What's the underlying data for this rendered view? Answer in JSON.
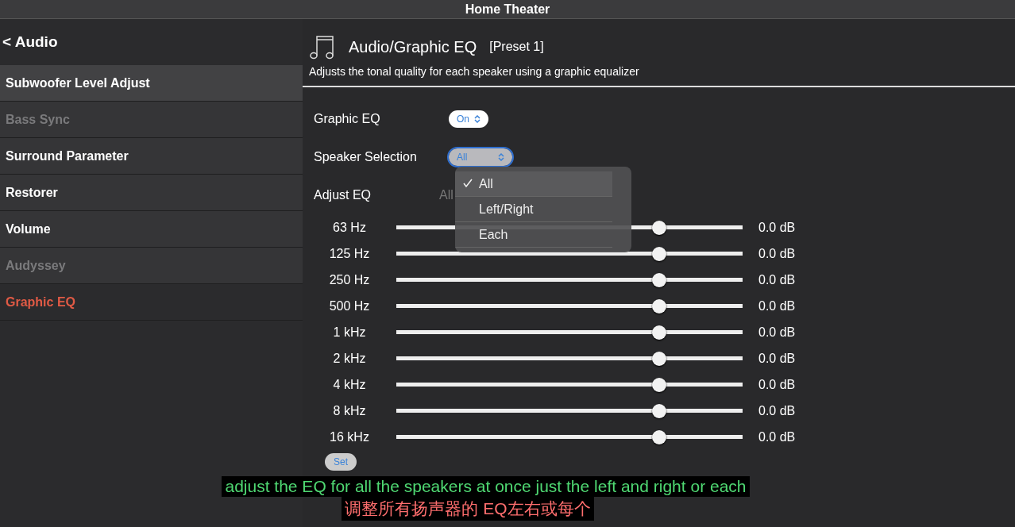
{
  "window": {
    "title": "Home Theater"
  },
  "sidebar": {
    "back": "< Audio",
    "items": [
      {
        "label": "Subwoofer Level Adjust",
        "selected": false,
        "disabled": false,
        "pressed": true
      },
      {
        "label": "Bass Sync",
        "selected": false,
        "disabled": true,
        "pressed": false
      },
      {
        "label": "Surround Parameter",
        "selected": false,
        "disabled": false,
        "pressed": false
      },
      {
        "label": "Restorer",
        "selected": false,
        "disabled": false,
        "pressed": false
      },
      {
        "label": "Volume",
        "selected": false,
        "disabled": false,
        "pressed": false
      },
      {
        "label": "Audyssey",
        "selected": false,
        "disabled": true,
        "pressed": false
      },
      {
        "label": "Graphic EQ",
        "selected": true,
        "disabled": false,
        "pressed": false
      }
    ]
  },
  "page": {
    "title": "Audio/Graphic EQ",
    "preset": "[Preset 1]",
    "description": "Adjusts the tonal quality for each speaker using a graphic equalizer"
  },
  "graphic_eq": {
    "label": "Graphic EQ",
    "value": "On"
  },
  "speaker_selection": {
    "label": "Speaker Selection",
    "value": "All",
    "focused": true,
    "menu": [
      {
        "label": "All",
        "selected": true
      },
      {
        "label": "Left/Right",
        "selected": false
      },
      {
        "label": "Each",
        "selected": false
      }
    ]
  },
  "adjust_eq": {
    "label": "Adjust EQ",
    "value": "All"
  },
  "bands": [
    {
      "name": "63 Hz",
      "level": 0.76,
      "reading": "0.0 dB"
    },
    {
      "name": "125 Hz",
      "level": 0.76,
      "reading": "0.0 dB"
    },
    {
      "name": "250 Hz",
      "level": 0.76,
      "reading": "0.0 dB"
    },
    {
      "name": "500 Hz",
      "level": 0.76,
      "reading": "0.0 dB"
    },
    {
      "name": "1 kHz",
      "level": 0.76,
      "reading": "0.0 dB"
    },
    {
      "name": "2 kHz",
      "level": 0.76,
      "reading": "0.0 dB"
    },
    {
      "name": "4 kHz",
      "level": 0.76,
      "reading": "0.0 dB"
    },
    {
      "name": "8 kHz",
      "level": 0.76,
      "reading": "0.0 dB"
    },
    {
      "name": "16 kHz",
      "level": 0.76,
      "reading": "0.0 dB"
    }
  ],
  "set_button": "Set",
  "subtitles": [
    "adjust the EQ for all the speakers at once just the left and right or each",
    "调整所有扬声器的 EQ左右或每个"
  ]
}
